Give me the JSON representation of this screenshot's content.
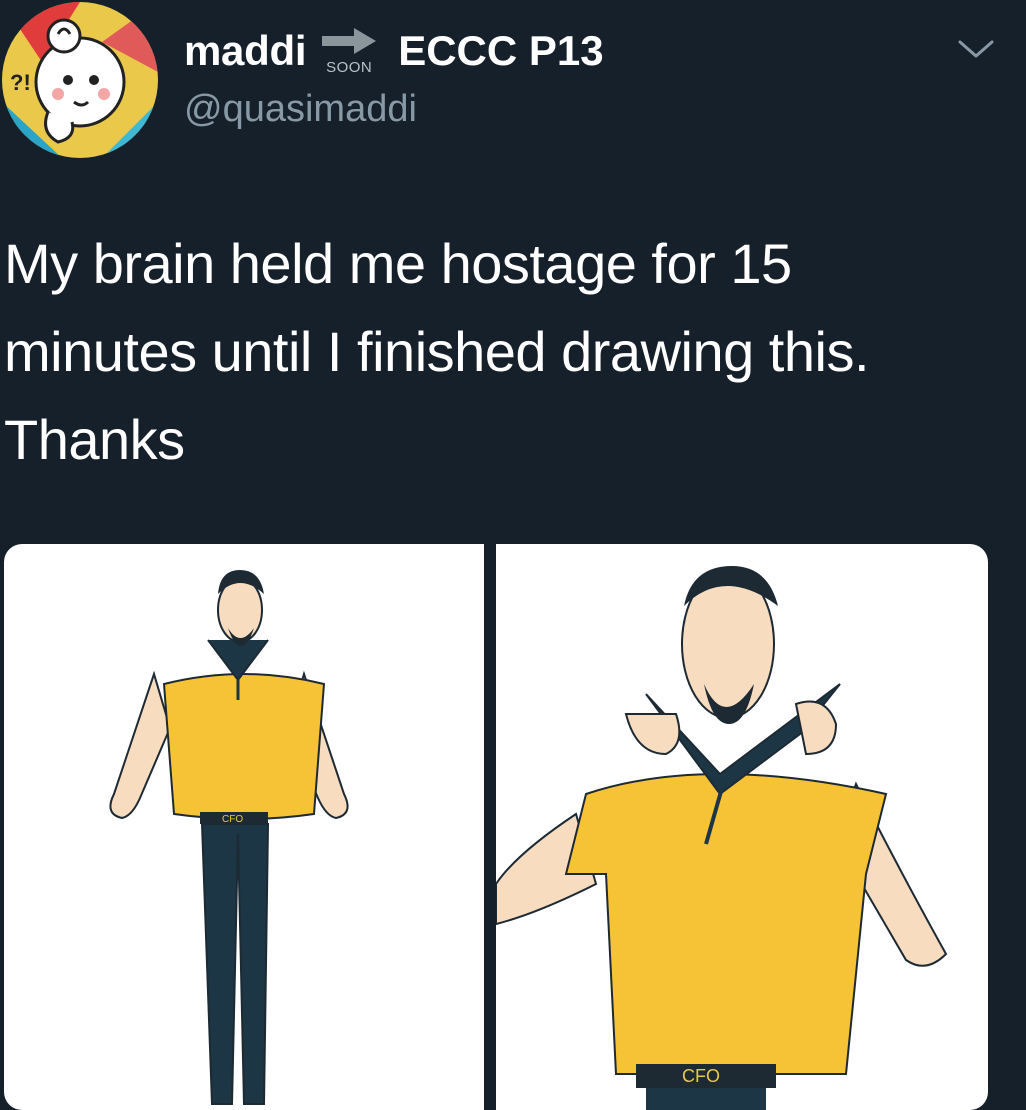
{
  "user": {
    "display_name": "maddi",
    "badge_text": "SOON",
    "name_suffix": "ECCC P13",
    "handle": "@quasimaddi",
    "avatar_icon": "cartoon-character-avatar"
  },
  "tweet": {
    "text_lines": [
      "My brain held me hostage for 15",
      "minutes until I finished drawing this.",
      "Thanks"
    ]
  },
  "media": {
    "images": [
      {
        "name": "full-body-drawing",
        "belt_buckle": "CFO"
      },
      {
        "name": "close-up-drawing",
        "belt_buckle": "CFO"
      }
    ]
  },
  "icons": {
    "menu": "chevron-down-icon",
    "arrow": "arrow-right-icon"
  },
  "colors": {
    "background": "#15202b",
    "handle": "#8899a6",
    "shirt": "#f6c236",
    "pants": "#1d3646",
    "skin": "#f7dcc0"
  }
}
